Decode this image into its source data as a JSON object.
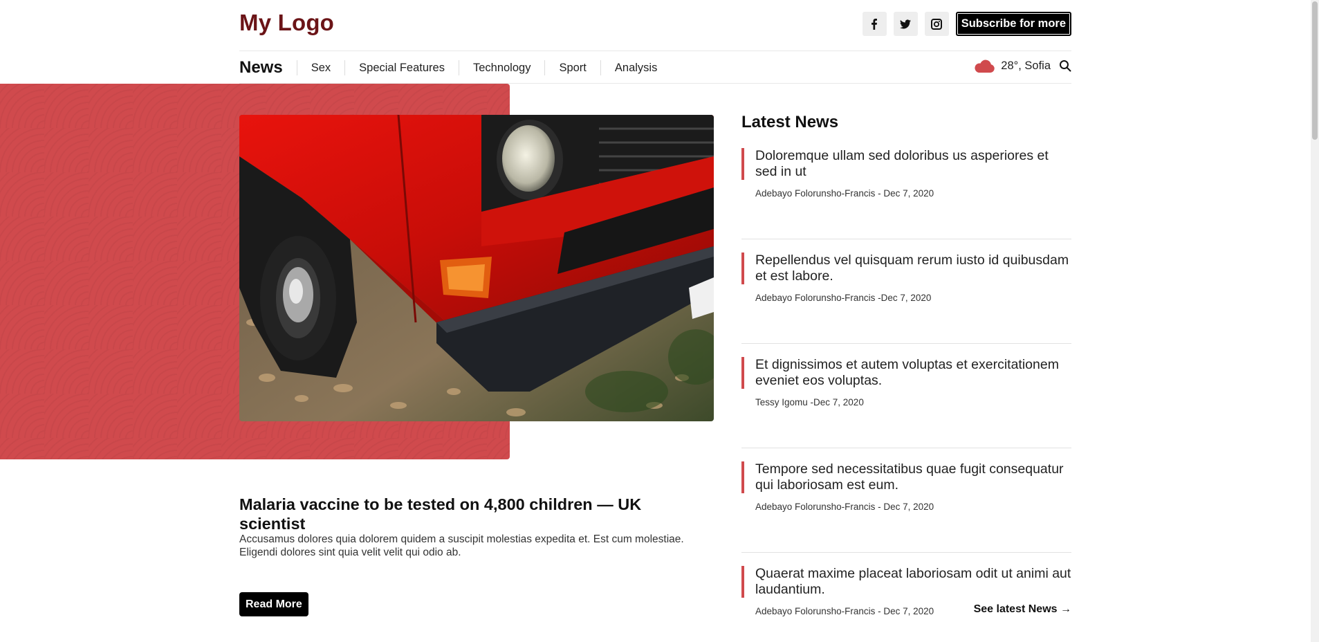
{
  "header": {
    "logo": "My Logo",
    "socials": [
      "facebook-icon",
      "twitter-icon",
      "instagram-icon"
    ],
    "subscribe_label": "Subscribe for more"
  },
  "nav": {
    "title": "News",
    "items": [
      "Sex",
      "Special Features",
      "Technology",
      "Sport",
      "Analysis"
    ],
    "weather": "28°, Sofia",
    "weather_icon": "cloud-icon",
    "search_icon": "search-icon"
  },
  "hero": {
    "image_alt": "red-van-front-closeup",
    "headline": "Malaria vaccine to be tested on 4,800 children — UK scientist",
    "excerpt": "Accusamus dolores quia dolorem quidem a suscipit molestias expedita et. Est cum molestiae. Eligendi dolores sint quia velit velit qui odio ab.",
    "read_more": "Read More"
  },
  "latest": {
    "title": "Latest News",
    "items": [
      {
        "title": "Doloremque ullam sed doloribus us asperiores et sed in ut",
        "meta": "Adebayo Folorunsho-Francis - Dec 7, 2020"
      },
      {
        "title": "Repellendus vel quisquam rerum iusto id quibusdam et est labore.",
        "meta": "Adebayo Folorunsho-Francis -Dec 7, 2020"
      },
      {
        "title": "Et dignissimos et autem voluptas et exercitationem eveniet eos voluptas.",
        "meta": "Tessy Igomu -Dec 7, 2020"
      },
      {
        "title": "Tempore sed necessitatibus quae fugit consequatur qui laboriosam est eum.",
        "meta": "Adebayo Folorunsho-Francis - Dec 7, 2020"
      },
      {
        "title": "Quaerat maxime placeat laboriosam odit ut animi aut laudantium.",
        "meta": "Adebayo Folorunsho-Francis - Dec 7, 2020"
      }
    ],
    "see_latest": "See latest News →"
  },
  "colors": {
    "accent": "#d04a4d",
    "logo": "#6b1417",
    "button": "#000000"
  }
}
